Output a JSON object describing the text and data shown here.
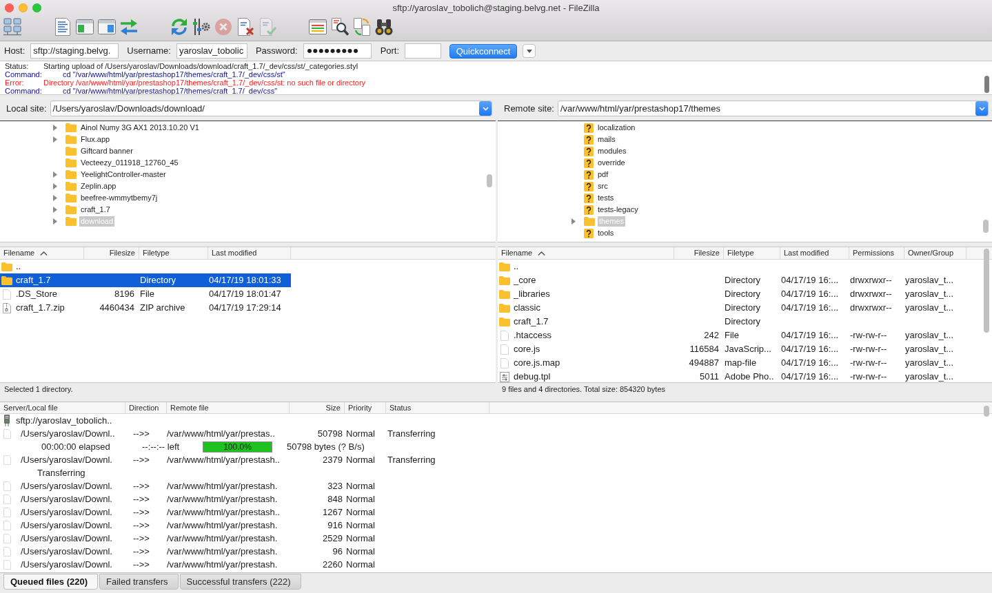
{
  "window": {
    "title": "sftp://yaroslav_tobolich@staging.belvg.net - FileZilla"
  },
  "toolbar": {
    "groups": [
      {
        "buttons": [
          {
            "kind": "sites",
            "disabled": false
          }
        ]
      },
      {
        "buttons": [
          {
            "kind": "log",
            "disabled": false
          },
          {
            "kind": "localtree",
            "disabled": false
          },
          {
            "kind": "remotetree",
            "disabled": false
          },
          {
            "kind": "queue",
            "disabled": false
          }
        ]
      },
      {
        "buttons": [
          {
            "kind": "refresh",
            "disabled": false
          },
          {
            "kind": "process",
            "disabled": false
          },
          {
            "kind": "cancel",
            "disabled": true
          },
          {
            "kind": "disconnect",
            "disabled": false
          },
          {
            "kind": "reconnect",
            "disabled": true
          }
        ]
      },
      {
        "buttons": [
          {
            "kind": "filter",
            "disabled": false
          },
          {
            "kind": "compare",
            "disabled": false
          },
          {
            "kind": "sync",
            "disabled": false
          },
          {
            "kind": "search",
            "disabled": false
          }
        ]
      }
    ]
  },
  "quickconnect": {
    "host_label": "Host:",
    "host": "sftp://staging.belvg.",
    "username_label": "Username:",
    "username": "yaroslav_tobolic",
    "password_label": "Password:",
    "password": "●●●●●●●●●",
    "port_label": "Port:",
    "button": "Quickconnect"
  },
  "log": [
    {
      "kind": "status",
      "label": "Status:",
      "text": "Starting upload of /Users/yaroslav/Downloads/download/craft_1.7/_dev/css/st/_categories.styl"
    },
    {
      "kind": "command",
      "label": "Command:",
      "text": "cd \"/var/www/html/yar/prestashop17/themes/craft_1.7/_dev/css/st\""
    },
    {
      "kind": "error",
      "label": "Error:",
      "text": "Directory /var/www/html/yar/prestashop17/themes/craft_1.7/_dev/css/st: no such file or directory"
    },
    {
      "kind": "command",
      "label": "Command:",
      "text": "cd \"/var/www/html/yar/prestashop17/themes/craft_1.7/_dev/css\""
    }
  ],
  "local": {
    "site_label": "Local site:",
    "path": "/Users/yaroslav/Downloads/download/",
    "tree": [
      {
        "name": "Ainol Numy 3G AX1 2013.10.20 V1",
        "kind": "folder",
        "expandable": true,
        "selected": false
      },
      {
        "name": "Flux.app",
        "kind": "folder",
        "expandable": true,
        "selected": false
      },
      {
        "name": "Giftcard banner",
        "kind": "folder",
        "expandable": false,
        "selected": false
      },
      {
        "name": "Vecteezy_011918_12760_45",
        "kind": "folder",
        "expandable": false,
        "selected": false
      },
      {
        "name": "YeelightController-master",
        "kind": "folder",
        "expandable": true,
        "selected": false
      },
      {
        "name": "Zeplin.app",
        "kind": "folder",
        "expandable": true,
        "selected": false
      },
      {
        "name": "beefree-wmmytbemy7j",
        "kind": "folder",
        "expandable": true,
        "selected": false
      },
      {
        "name": "craft_1.7",
        "kind": "folder",
        "expandable": true,
        "selected": false
      },
      {
        "name": "download",
        "kind": "folder",
        "expandable": true,
        "selected": true
      }
    ],
    "columns": [
      {
        "label": "Filename",
        "sorted": true
      },
      {
        "label": "Filesize",
        "sorted": false
      },
      {
        "label": "Filetype",
        "sorted": false
      },
      {
        "label": "Last modified",
        "sorted": false
      }
    ],
    "rows": [
      {
        "kind": "folder",
        "name": "..",
        "selected": false
      },
      {
        "kind": "folder",
        "name": "craft_1.7",
        "type": "Directory",
        "modified": "04/17/19 18:01:33",
        "selected": true
      },
      {
        "kind": "file",
        "name": ".DS_Store",
        "size": "8196",
        "type": "File",
        "modified": "04/17/19 18:01:47",
        "selected": false
      },
      {
        "kind": "zip",
        "name": "craft_1.7.zip",
        "size": "4460434",
        "type": "ZIP archive",
        "modified": "04/17/19 17:29:14",
        "selected": false
      }
    ],
    "status": "Selected 1 directory."
  },
  "remote": {
    "site_label": "Remote site:",
    "path": "/var/www/html/yar/prestashop17/themes",
    "tree": [
      {
        "name": "localization",
        "kind": "unknown",
        "expandable": false,
        "selected": false
      },
      {
        "name": "mails",
        "kind": "unknown",
        "expandable": false,
        "selected": false
      },
      {
        "name": "modules",
        "kind": "unknown",
        "expandable": false,
        "selected": false
      },
      {
        "name": "override",
        "kind": "unknown",
        "expandable": false,
        "selected": false
      },
      {
        "name": "pdf",
        "kind": "unknown",
        "expandable": false,
        "selected": false
      },
      {
        "name": "src",
        "kind": "unknown",
        "expandable": false,
        "selected": false
      },
      {
        "name": "tests",
        "kind": "unknown",
        "expandable": false,
        "selected": false
      },
      {
        "name": "tests-legacy",
        "kind": "unknown",
        "expandable": false,
        "selected": false
      },
      {
        "name": "themes",
        "kind": "folder",
        "expandable": true,
        "selected": true
      },
      {
        "name": "tools",
        "kind": "unknown",
        "expandable": false,
        "selected": false
      }
    ],
    "columns": [
      {
        "label": "Filename",
        "sorted": true
      },
      {
        "label": "Filesize",
        "sorted": false
      },
      {
        "label": "Filetype",
        "sorted": false
      },
      {
        "label": "Last modified",
        "sorted": false
      },
      {
        "label": "Permissions",
        "sorted": false
      },
      {
        "label": "Owner/Group",
        "sorted": false
      }
    ],
    "rows": [
      {
        "kind": "folder",
        "name": "..",
        "selected": false
      },
      {
        "kind": "folder",
        "name": "_core",
        "type": "Directory",
        "modified": "04/17/19 16:...",
        "permissions": "drwxrwxr--",
        "owner": "yaroslav_t...",
        "selected": false
      },
      {
        "kind": "folder",
        "name": "_libraries",
        "type": "Directory",
        "modified": "04/17/19 16:...",
        "permissions": "drwxrwxr--",
        "owner": "yaroslav_t...",
        "selected": false
      },
      {
        "kind": "folder",
        "name": "classic",
        "type": "Directory",
        "modified": "04/17/19 16:...",
        "permissions": "drwxrwxr--",
        "owner": "yaroslav_t...",
        "selected": false
      },
      {
        "kind": "folder",
        "name": "craft_1.7",
        "type": "Directory",
        "selected": false
      },
      {
        "kind": "file",
        "name": ".htaccess",
        "size": "242",
        "type": "File",
        "modified": "04/17/19 16:...",
        "permissions": "-rw-rw-r--",
        "owner": "yaroslav_t...",
        "selected": false
      },
      {
        "kind": "file",
        "name": "core.js",
        "size": "116584",
        "type": "JavaScrip...",
        "modified": "04/17/19 16:...",
        "permissions": "-rw-rw-r--",
        "owner": "yaroslav_t...",
        "selected": false
      },
      {
        "kind": "file",
        "name": "core.js.map",
        "size": "494887",
        "type": "map-file",
        "modified": "04/17/19 16:...",
        "permissions": "-rw-rw-r--",
        "owner": "yaroslav_t...",
        "selected": false
      },
      {
        "kind": "template",
        "name": "debug.tpl",
        "size": "5011",
        "type": "Adobe Pho..",
        "modified": "04/17/19 16:...",
        "permissions": "-rw-rw-r--",
        "owner": "yaroslav_t...",
        "selected": false
      }
    ],
    "status": "9 files and 4 directories. Total size: 854320 bytes"
  },
  "queue": {
    "columns": [
      {
        "label": "Server/Local file"
      },
      {
        "label": "Direction"
      },
      {
        "label": "Remote file"
      },
      {
        "label": "Size"
      },
      {
        "label": "Priority"
      },
      {
        "label": "Status"
      }
    ],
    "rows": [
      {
        "kind": "server",
        "local": "sftp://yaroslav_tobolich.."
      },
      {
        "kind": "file",
        "local": "/Users/yaroslav/Downl..",
        "direction": "-->>",
        "remote": "/var/www/html/yar/prestas..",
        "size": "50798",
        "priority": "Normal",
        "status": "Transferring"
      },
      {
        "kind": "progress",
        "elapsed": "00:00:00 elapsed",
        "left": "--:--:-- left",
        "level": 1,
        "percent": "100.0%",
        "bytes": "50798 bytes (? B/s)"
      },
      {
        "kind": "file",
        "local": "/Users/yaroslav/Downl.",
        "direction": "-->>",
        "remote": "/var/www/html/yar/prestash..",
        "size": "2379",
        "priority": "Normal",
        "status": "Transferring"
      },
      {
        "kind": "message",
        "text": "Transferring"
      },
      {
        "kind": "file",
        "local": "/Users/yaroslav/Downl.",
        "direction": "-->>",
        "remote": "/var/www/html/yar/prestash.",
        "size": "323",
        "priority": "Normal"
      },
      {
        "kind": "file",
        "local": "/Users/yaroslav/Downl.",
        "direction": "-->>",
        "remote": "/var/www/html/yar/prestash.",
        "size": "848",
        "priority": "Normal"
      },
      {
        "kind": "file",
        "local": "/Users/yaroslav/Downl.",
        "direction": "-->>",
        "remote": "/var/www/html/yar/prestash..",
        "size": "1267",
        "priority": "Normal"
      },
      {
        "kind": "file",
        "local": "/Users/yaroslav/Downl.",
        "direction": "-->>",
        "remote": "/var/www/html/yar/prestash.",
        "size": "916",
        "priority": "Normal"
      },
      {
        "kind": "file",
        "local": "/Users/yaroslav/Downl.",
        "direction": "-->>",
        "remote": "/var/www/html/yar/prestash.",
        "size": "2529",
        "priority": "Normal"
      },
      {
        "kind": "file",
        "local": "/Users/yaroslav/Downl.",
        "direction": "-->>",
        "remote": "/var/www/html/yar/prestash.",
        "size": "96",
        "priority": "Normal"
      },
      {
        "kind": "file",
        "local": "/Users/yaroslav/Downl.",
        "direction": "-->>",
        "remote": "/var/www/html/yar/prestash.",
        "size": "2260",
        "priority": "Normal"
      }
    ]
  },
  "tabs": [
    {
      "label": "Queued files (220)",
      "selected": true
    },
    {
      "label": "Failed transfers",
      "selected": false
    },
    {
      "label": "Successful transfers (222)",
      "selected": false
    }
  ]
}
